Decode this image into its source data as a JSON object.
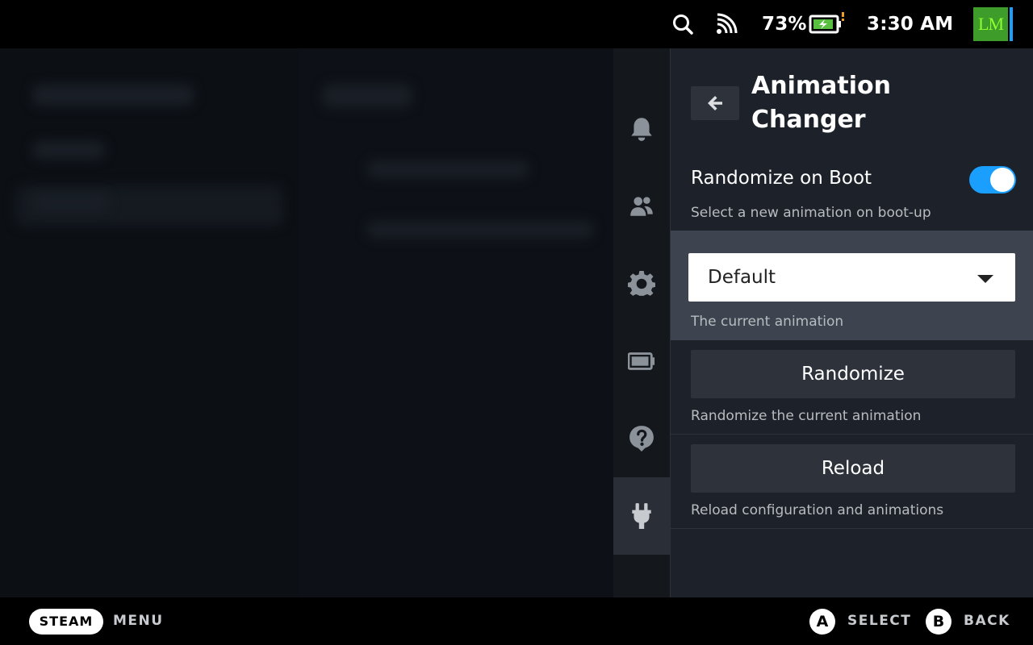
{
  "status_bar": {
    "battery_percent": "73%",
    "time": "3:30 AM",
    "avatar_text": "LM"
  },
  "panel": {
    "title": "Animation Changer",
    "randomize_on_boot": {
      "label": "Randomize on Boot",
      "description": "Select a new animation on boot-up",
      "enabled": true
    },
    "animation_select": {
      "value": "Default",
      "description": "The current animation"
    },
    "randomize": {
      "button": "Randomize",
      "description": "Randomize the current animation"
    },
    "reload": {
      "button": "Reload",
      "description": "Reload configuration and animations"
    }
  },
  "rail": [
    "bell-icon",
    "friends-icon",
    "gear-icon",
    "battery-icon",
    "help-icon",
    "plug-icon"
  ],
  "bottom_bar": {
    "steam": "STEAM",
    "menu": "MENU",
    "a_key": "A",
    "select": "SELECT",
    "b_key": "B",
    "back": "BACK"
  },
  "colors": {
    "accent": "#1a9fff",
    "panel_bg": "#1d222a",
    "highlight": "#3d4450"
  }
}
